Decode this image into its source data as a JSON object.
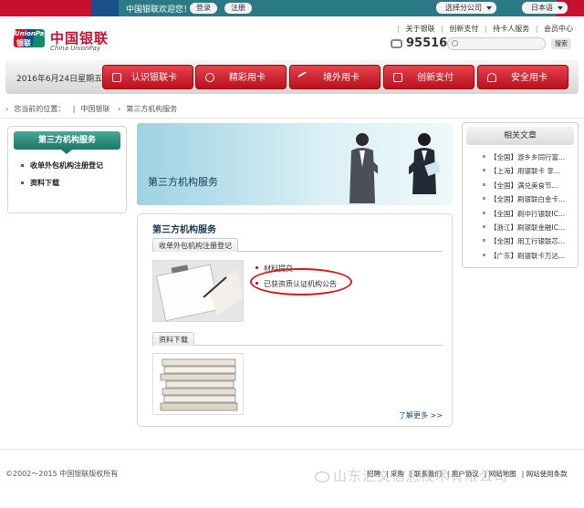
{
  "topbar": {
    "welcome": "中国银联欢迎您！",
    "login": "登录",
    "register": "注册",
    "branch_select": "选择分公司",
    "language_select": "日本语"
  },
  "header": {
    "logo_mark_en": "UnionPay",
    "logo_mark_cn": "银联",
    "logo_cn": "中国银联",
    "logo_en": "China UnionPay",
    "links": [
      "关于银联",
      "创新支付",
      "持卡人服务",
      "会员中心"
    ],
    "phone": "95516",
    "search_button": "搜索"
  },
  "nav": {
    "date": "2016年6月24日星期五",
    "items": [
      "认识银联卡",
      "精彩用卡",
      "境外用卡",
      "创新支付",
      "安全用卡"
    ]
  },
  "breadcrumb": {
    "label": "您当前的位置：",
    "items": [
      "中国银联",
      "第三方机构服务"
    ]
  },
  "left_panel": {
    "title": "第三方机构服务",
    "items": [
      "收单外包机构注册登记",
      "资料下载"
    ]
  },
  "banner": {
    "title": "第三方机构服务"
  },
  "main": {
    "title": "第三方机构服务",
    "tab1": "收单外包机构注册登记",
    "tab1_links": [
      "材料提交",
      "已获资质认证机构公告"
    ],
    "tab2": "资料下载",
    "more": "了解更多 >>"
  },
  "right_panel": {
    "title": "相关文章",
    "items": [
      "【全国】游乡乡同行富...",
      "【上海】用银联卡 享...",
      "【全国】满兑美食节...",
      "【全国】刷银联白金卡...",
      "【全国】刷中行银联IC...",
      "【浙江】刷银联金融IC...",
      "【全国】用工行银联芯...",
      "【广东】刷银联卡万达..."
    ]
  },
  "footer": {
    "copyright": "©2002～2015 中国银联版权所有",
    "links": [
      "招聘",
      "采购",
      "联系我们",
      "用户协议",
      "网站地图",
      "网站使用条款"
    ],
    "watermark": "山东汇文信息技术有限公司"
  }
}
